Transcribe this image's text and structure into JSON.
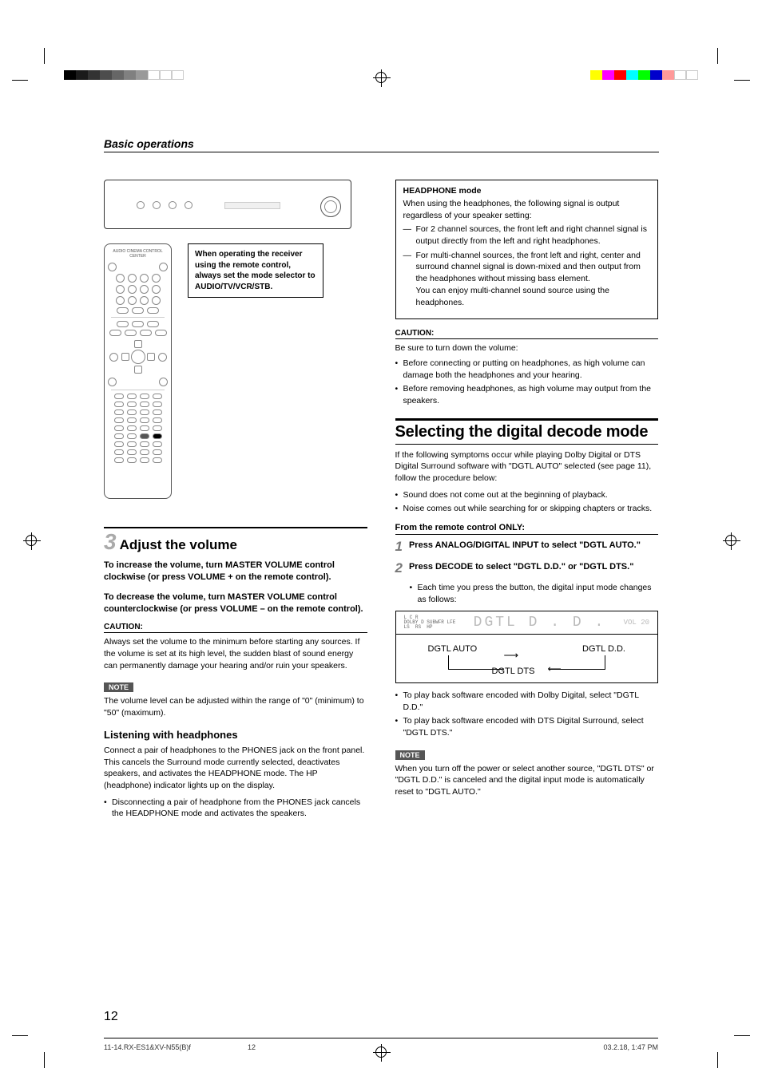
{
  "section_header": "Basic operations",
  "remote_note": "When operating the receiver using the remote control, always set the mode selector to AUDIO/TV/VCR/STB.",
  "remote_title": "AUDIO CINEMA CONTROL CENTER",
  "step3": {
    "num": "3",
    "title": "Adjust the volume",
    "increase": "To increase the volume, turn MASTER VOLUME control clockwise (or press VOLUME + on the remote control).",
    "decrease": "To decrease the volume, turn MASTER VOLUME control counterclockwise (or press VOLUME – on the remote control).",
    "caution_label": "CAUTION:",
    "caution_text": "Always set the volume to the minimum before starting any sources. If the volume is set at its high level, the sudden blast of sound energy can permanently damage your hearing and/or ruin your speakers.",
    "note_label": "NOTE",
    "note_text": "The volume level can be adjusted within the range of \"0\" (minimum) to \"50\" (maximum)."
  },
  "headphones": {
    "heading": "Listening with headphones",
    "p1": "Connect a pair of headphones to the PHONES jack on the front panel. This cancels the Surround mode currently selected, deactivates speakers, and activates the HEADPHONE mode. The HP (headphone) indicator lights up on the display.",
    "bullet1": "Disconnecting a pair of headphone from the PHONES jack cancels the HEADPHONE mode and activates the speakers."
  },
  "hp_mode": {
    "title": "HEADPHONE mode",
    "intro": "When using the headphones, the following signal is output regardless of your speaker setting:",
    "d1": "For 2 channel sources, the front left and right channel signal is output directly from the left and right headphones.",
    "d2": "For multi-channel sources, the front left and right, center and surround channel signal is down-mixed and then output from the headphones without missing bass element.",
    "d2b": "You can enjoy multi-channel sound source using the headphones."
  },
  "r_caution": {
    "label": "CAUTION:",
    "intro": "Be sure to turn down the volume:",
    "b1": "Before connecting or putting on headphones, as high volume can damage both the headphones and your hearing.",
    "b2": "Before removing headphones, as high volume may output from the speakers."
  },
  "decode": {
    "title": "Selecting the digital decode mode",
    "intro": "If the following symptoms occur while playing Dolby Digital or DTS Digital Surround software with \"DGTL AUTO\" selected (see page 11), follow the procedure below:",
    "b1": "Sound does not come out at the beginning of playback.",
    "b2": "Noise comes out while searching for or skipping chapters or tracks.",
    "from": "From the remote control ONLY:",
    "s1n": "1",
    "s1t": "Press ANALOG/DIGITAL INPUT to select \"DGTL AUTO.\"",
    "s2n": "2",
    "s2t": "Press DECODE to select \"DGTL D.D.\" or \"DGTL DTS.\"",
    "s2sub": "Each time you press the button, the digital input mode changes as follows:",
    "lcd_text": "DGTL  D . D .",
    "lcd_vol": "VOL 20",
    "lcd_icons": "L C R\nDOLBY D SUBWFR LFE\nLS  RS  HP",
    "flow_auto": "DGTL AUTO",
    "flow_dd": "DGTL D.D.",
    "flow_dts": "DGTL DTS",
    "post1": "To play back software encoded with Dolby Digital, select \"DGTL D.D.\"",
    "post2": "To play back software encoded with DTS Digital Surround, select \"DGTL DTS.\"",
    "note_label": "NOTE",
    "note_text": "When you turn off the power or select another source, \"DGTL DTS\" or \"DGTL D.D.\" is canceled and the digital input mode is automatically reset to \"DGTL AUTO.\""
  },
  "page_number": "12",
  "footer": {
    "file": "11-14.RX-ES1&XV-N55(B)f",
    "page": "12",
    "date": "03.2.18, 1:47 PM"
  },
  "colorbars_left": [
    "#000",
    "#000",
    "#000",
    "#000",
    "#000",
    "#000",
    "#000",
    "#fff",
    "#fff",
    "#fff",
    "#fff"
  ],
  "colorbars_left_alpha": [
    1,
    0.9,
    0.8,
    0.7,
    0.55,
    0.4,
    0.25,
    1,
    1,
    1,
    1
  ],
  "colorbars_right": [
    "#ff0",
    "#f0f",
    "#f00",
    "#0ff",
    "#0f0",
    "#00c",
    "#f99",
    "#fff",
    "#fff",
    "#fff"
  ]
}
